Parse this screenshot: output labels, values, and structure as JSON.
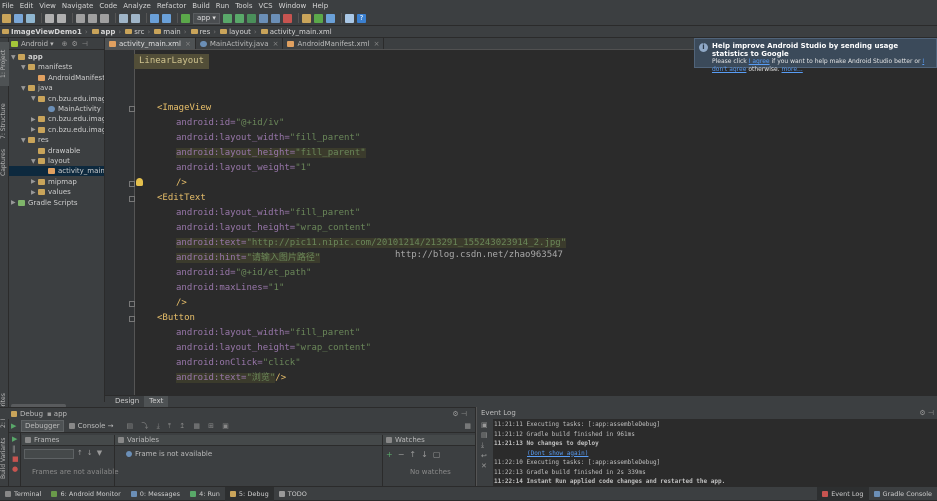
{
  "menu": [
    "File",
    "Edit",
    "View",
    "Navigate",
    "Code",
    "Analyze",
    "Refactor",
    "Build",
    "Run",
    "Tools",
    "VCS",
    "Window",
    "Help"
  ],
  "toolbar": {
    "run_config": "app"
  },
  "breadcrumbs": [
    {
      "label": "ImageViewDemo1",
      "bold": true
    },
    {
      "label": "app",
      "bold": true
    },
    {
      "label": "src",
      "bold": false
    },
    {
      "label": "main",
      "bold": false
    },
    {
      "label": "res",
      "bold": false
    },
    {
      "label": "layout",
      "bold": false
    },
    {
      "label": "activity_main.xml",
      "bold": false
    }
  ],
  "left_strip_tabs": [
    "1: Project",
    "7: Structure",
    "Captures",
    "2: Favorites",
    "Build Variants"
  ],
  "project": {
    "view_selector": "Android",
    "tree": [
      {
        "label": "app",
        "depth": 0,
        "arrow": "▼",
        "icon": "folder",
        "bold": true
      },
      {
        "label": "manifests",
        "depth": 1,
        "arrow": "▼",
        "icon": "folder"
      },
      {
        "label": "AndroidManifest.xml",
        "depth": 2,
        "arrow": "",
        "icon": "file"
      },
      {
        "label": "java",
        "depth": 1,
        "arrow": "▼",
        "icon": "folder"
      },
      {
        "label": "cn.bzu.edu.imageviewdemo1",
        "depth": 2,
        "arrow": "▼",
        "icon": "package"
      },
      {
        "label": "MainActivity",
        "depth": 3,
        "arrow": "",
        "icon": "class"
      },
      {
        "label": "cn.bzu.edu.imageviewdemo1",
        "depth": 2,
        "arrow": "▶",
        "icon": "package"
      },
      {
        "label": "cn.bzu.edu.imageviewdemo1",
        "depth": 2,
        "arrow": "▶",
        "icon": "package"
      },
      {
        "label": "res",
        "depth": 1,
        "arrow": "▼",
        "icon": "folder"
      },
      {
        "label": "drawable",
        "depth": 2,
        "arrow": "",
        "icon": "folder"
      },
      {
        "label": "layout",
        "depth": 2,
        "arrow": "▼",
        "icon": "folder"
      },
      {
        "label": "activity_main.xml",
        "depth": 3,
        "arrow": "",
        "icon": "file",
        "selected": true
      },
      {
        "label": "mipmap",
        "depth": 2,
        "arrow": "▶",
        "icon": "folder"
      },
      {
        "label": "values",
        "depth": 2,
        "arrow": "▶",
        "icon": "folder"
      },
      {
        "label": "Gradle Scripts",
        "depth": 0,
        "arrow": "▶",
        "icon": "gradle"
      }
    ]
  },
  "editor_tabs": [
    {
      "label": "activity_main.xml",
      "active": true
    },
    {
      "label": "MainActivity.java",
      "active": false
    },
    {
      "label": "AndroidManifest.xml",
      "active": false
    }
  ],
  "editor": {
    "breadcrumb_tag": "LinearLayout",
    "lines": [
      {
        "text": "<ImageView",
        "indent": false,
        "kind": "tag"
      },
      {
        "attr": "android:id=",
        "val": "\"@+id/iv\"",
        "indent": true
      },
      {
        "attr": "android:layout_width=",
        "val": "\"fill_parent\"",
        "indent": true
      },
      {
        "attr": "android:layout_height=",
        "val": "\"fill_parent\"",
        "indent": true,
        "hl": true
      },
      {
        "attr": "android:layout_weight=",
        "val": "\"1\"",
        "indent": true
      },
      {
        "text": "/>",
        "indent": true,
        "kind": "tag"
      },
      {
        "text": "<EditText",
        "indent": false,
        "kind": "tag"
      },
      {
        "attr": "android:layout_width=",
        "val": "\"fill_parent\"",
        "indent": true
      },
      {
        "attr": "android:layout_height=",
        "val": "\"wrap_content\"",
        "indent": true
      },
      {
        "attr": "android:text=",
        "val": "\"http://pic11.nipic.com/20101214/213291_155243023914_2.jpg\"",
        "indent": true,
        "hl": true
      },
      {
        "attr": "android:hint=",
        "val": "\"请输入图片路径\"",
        "indent": true,
        "hl": true
      },
      {
        "attr": "android:id=",
        "val": "\"@+id/et_path\"",
        "indent": true
      },
      {
        "attr": "android:maxLines=",
        "val": "\"1\"",
        "indent": true
      },
      {
        "text": "/>",
        "indent": true,
        "kind": "tag"
      },
      {
        "text": "<Button",
        "indent": false,
        "kind": "tag"
      },
      {
        "attr": "android:layout_width=",
        "val": "\"fill_parent\"",
        "indent": true
      },
      {
        "attr": "android:layout_height=",
        "val": "\"wrap_content\"",
        "indent": true
      },
      {
        "attr": "android:onClick=",
        "val": "\"click\"",
        "indent": true
      },
      {
        "attr": "android:text=",
        "val": "\"浏览\"",
        "tail": "/>",
        "indent": true,
        "hl": true
      }
    ],
    "watermark": "http://blog.csdn.net/zhao963547"
  },
  "design_tabs": [
    {
      "label": "Design",
      "active": false
    },
    {
      "label": "Text",
      "active": true
    }
  ],
  "notification": {
    "title": "Help improve Android Studio by sending usage statistics to Google",
    "pre": "Please click ",
    "agree": "I agree",
    "mid": " if you want to help make Android Studio better or ",
    "dont": "I don't agree",
    "post": " otherwise. ",
    "more": "more..."
  },
  "debug": {
    "header": "Debug",
    "config": "app",
    "tabs": [
      "Debugger",
      "Console"
    ],
    "frames_title": "Frames",
    "frames_empty": "Frames are not available",
    "variables_title": "Variables",
    "variables_msg": "Frame is not available",
    "watches_title": "Watches",
    "watches_empty": "No watches"
  },
  "event_log": {
    "title": "Event Log",
    "lines": [
      {
        "text": "11:21:11 Executing tasks: [:app:assembleDebug]"
      },
      {
        "text": "11:21:12 Gradle build finished in 961ms"
      },
      {
        "text": "11:21:13 No changes to deploy",
        "bold": true
      },
      {
        "text": "(Dont show again)",
        "link": true,
        "indent": true
      },
      {
        "text": "11:22:10 Executing tasks: [:app:assembleDebug]"
      },
      {
        "text": "11:22:13 Gradle build finished in 2s 339ms"
      },
      {
        "text": "11:22:14 Instant Run applied code changes and restarted the app.",
        "bold": true
      }
    ]
  },
  "statusbar": {
    "left": [
      {
        "label": "Terminal",
        "color": "#888888"
      },
      {
        "label": "6: Android Monitor",
        "color": "#6a9a4a"
      },
      {
        "label": "0: Messages",
        "color": "#6b8fb7"
      },
      {
        "label": "4: Run",
        "color": "#59a869"
      },
      {
        "label": "5: Debug",
        "color": "#c9a45a",
        "active": true
      },
      {
        "label": "TODO",
        "color": "#9a9a9a"
      }
    ],
    "right": [
      {
        "label": "Event Log",
        "color": "#c75450",
        "active": true
      },
      {
        "label": "Gradle Console",
        "color": "#6b8fb7"
      }
    ]
  },
  "colors": {
    "tag": "#e8bf6a",
    "attr": "#9876aa",
    "value": "#6a8759",
    "selection": "#0d293e"
  }
}
